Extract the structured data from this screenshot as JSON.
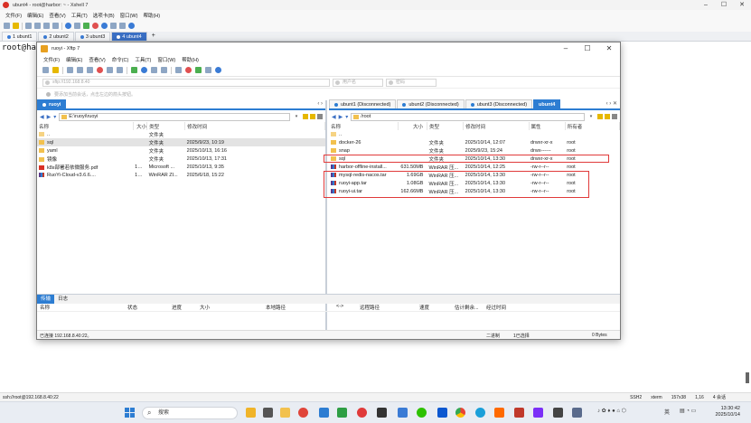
{
  "xshell": {
    "title": "ubunt4 - root@harbor: ~ - Xshell 7",
    "menu": [
      "文件(F)",
      "编辑(E)",
      "查看(V)",
      "工具(T)",
      "选项卡(B)",
      "窗口(W)",
      "帮助(H)"
    ],
    "tabs": [
      {
        "label": "1 ubunt1",
        "active": false
      },
      {
        "label": "2 ubunt2",
        "active": false
      },
      {
        "label": "3 ubunt3",
        "active": false
      },
      {
        "label": "4 ubunt4",
        "active": true
      }
    ],
    "prompt": "root@har",
    "status": {
      "left": "ssh://root@192.168.8.40:22",
      "ssh": "SSH2",
      "term": "xterm",
      "size": "157x38",
      "pos": "1,16",
      "sessions": "4 会话"
    }
  },
  "xftp": {
    "title": "ruoyi - Xftp 7",
    "menu": [
      "文件(F)",
      "编辑(E)",
      "查看(V)",
      "命令(C)",
      "工具(T)",
      "窗口(W)",
      "帮助(H)"
    ],
    "address_placeholder": "sftp://192.168.8.40",
    "user_placeholder": "用户名",
    "password_placeholder": "密码",
    "hint": "要添加当前会话，点击左边的箭头按钮。",
    "left_pane": {
      "tab": "ruoyi",
      "path": "E:\\ruoyi\\ruoyi",
      "columns": [
        "名称",
        "大小",
        "类型",
        "修改时间"
      ],
      "rows": [
        {
          "name": "..",
          "size": "",
          "type": "文件夹",
          "mtime": "",
          "icon": "up"
        },
        {
          "name": "sql",
          "size": "",
          "type": "文件夹",
          "mtime": "2025/9/23, 10:19",
          "icon": "folder",
          "selected": true
        },
        {
          "name": "yaml",
          "size": "",
          "type": "文件夹",
          "mtime": "2025/10/13, 16:16",
          "icon": "folder"
        },
        {
          "name": "镜像",
          "size": "",
          "type": "文件夹",
          "mtime": "2025/10/13, 17:31",
          "icon": "folder"
        },
        {
          "name": "k8s部署若依微服务.pdf",
          "size": "1.06MB",
          "type": "Microsoft ...",
          "mtime": "2025/10/13, 9:35",
          "icon": "pdf"
        },
        {
          "name": "RuoYi-Cloud-v3.6.6....",
          "size": "1.81MB",
          "type": "WinRAR ZI...",
          "mtime": "2025/6/18, 15:22",
          "icon": "rar"
        }
      ]
    },
    "right_pane": {
      "tabs": [
        {
          "label": "ubunt1 (Disconnected)",
          "active": false
        },
        {
          "label": "ubunt2 (Disconnected)",
          "active": false
        },
        {
          "label": "ubunt3 (Disconnected)",
          "active": false
        },
        {
          "label": "ubunt4",
          "active": true
        }
      ],
      "path": "/root",
      "columns": [
        "名称",
        "大小",
        "类型",
        "修改时间",
        "属性",
        "所有者"
      ],
      "rows": [
        {
          "name": "..",
          "size": "",
          "type": "",
          "mtime": "",
          "attr": "",
          "owner": "",
          "icon": "up"
        },
        {
          "name": "docker-26",
          "size": "",
          "type": "文件夹",
          "mtime": "2025/10/14, 12:07",
          "attr": "drwxr-xr-x",
          "owner": "root",
          "icon": "folder"
        },
        {
          "name": "snap",
          "size": "",
          "type": "文件夹",
          "mtime": "2025/9/23, 15:24",
          "attr": "drwx------",
          "owner": "root",
          "icon": "folder"
        },
        {
          "name": "sql",
          "size": "",
          "type": "文件夹",
          "mtime": "2025/10/14, 13:30",
          "attr": "drwxr-xr-x",
          "owner": "root",
          "icon": "folder"
        },
        {
          "name": "harbor-offline-install...",
          "size": "631.50MB",
          "type": "WinRAR 压...",
          "mtime": "2025/10/14, 12:25",
          "attr": "-rw-r--r--",
          "owner": "root",
          "icon": "rar"
        },
        {
          "name": "mysql-redis-nacos.tar",
          "size": "1.69GB",
          "type": "WinRAR 压...",
          "mtime": "2025/10/14, 13:30",
          "attr": "-rw-r--r--",
          "owner": "root",
          "icon": "rar"
        },
        {
          "name": "ruoyi-app.tar",
          "size": "1.08GB",
          "type": "WinRAR 压...",
          "mtime": "2025/10/14, 13:30",
          "attr": "-rw-r--r--",
          "owner": "root",
          "icon": "rar"
        },
        {
          "name": "ruoyi-ui.tar",
          "size": "162.66MB",
          "type": "WinRAR 压...",
          "mtime": "2025/10/14, 13:30",
          "attr": "-rw-r--r--",
          "owner": "root",
          "icon": "rar"
        }
      ]
    },
    "transfer": {
      "tabs": [
        "传输",
        "日志"
      ],
      "columns": [
        "名称",
        "状态",
        "进度",
        "大小",
        "本地路径",
        "<->",
        "远程路径",
        "速度",
        "估计剩余...",
        "经过时间"
      ]
    },
    "status": {
      "left": "已连接 192.168.8.40:22。",
      "mode": "二进制",
      "objects": "1已选择",
      "bytes": "0 Bytes"
    }
  },
  "taskbar": {
    "search": "搜索",
    "ime": "英",
    "time": "13:30:42",
    "date": "2025/10/14"
  }
}
